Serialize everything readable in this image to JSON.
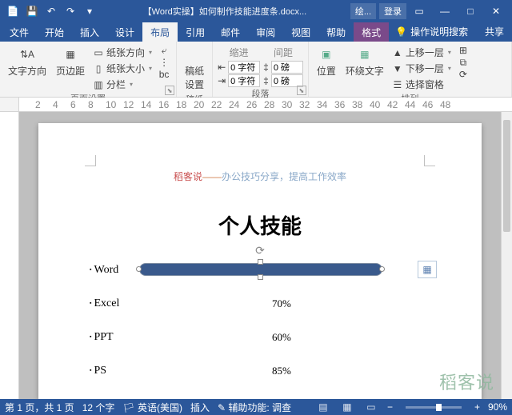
{
  "titlebar": {
    "title": "【Word实操】如何制作技能进度条.docx...",
    "app_badge": "绘...",
    "login": "登录"
  },
  "tabs": {
    "file": "文件",
    "home": "开始",
    "insert": "插入",
    "design": "设计",
    "layout": "布局",
    "references": "引用",
    "mailings": "邮件",
    "review": "审阅",
    "view": "视图",
    "help": "帮助",
    "format": "格式",
    "tell": "操作说明搜索",
    "share": "共享"
  },
  "ribbon": {
    "page_setup": {
      "label": "页面设置",
      "text_direction": "文字方向",
      "margins": "页边距",
      "orientation": "纸张方向",
      "size": "纸张大小",
      "columns": "分栏"
    },
    "manuscript": {
      "label": "稿纸",
      "settings": "稿纸\n设置"
    },
    "paragraph": {
      "label": "段落",
      "indent": "缩进",
      "spacing": "间距",
      "left_val": "0 字符",
      "right_val": "0 字符",
      "before_val": "0 磅",
      "after_val": "0 磅"
    },
    "arrange": {
      "label": "排列",
      "position": "位置",
      "wrap": "环绕文字",
      "bring_forward": "上移一层",
      "send_backward": "下移一层",
      "selection_pane": "选择窗格"
    }
  },
  "document": {
    "header": {
      "brand": "稻客说",
      "dash": "——",
      "tagline": "办公技巧分享，提高工作效率"
    },
    "title": "个人技能",
    "skills": [
      {
        "name": "Word",
        "value": ""
      },
      {
        "name": "Excel",
        "value": "70%"
      },
      {
        "name": "PPT",
        "value": "60%"
      },
      {
        "name": "PS",
        "value": "85%"
      }
    ]
  },
  "ruler": {
    "h": [
      "2",
      "4",
      "6",
      "8",
      "10",
      "12",
      "14",
      "16",
      "18",
      "20",
      "22",
      "24",
      "26",
      "28",
      "30",
      "32",
      "34",
      "36",
      "38",
      "40",
      "42",
      "44",
      "46",
      "48"
    ]
  },
  "status": {
    "page": "第 1 页，共 1 页",
    "words": "12 个字",
    "lang": "英语(美国)",
    "insert": "插入",
    "a11y": "辅助功能: 调查",
    "zoom": "90%"
  },
  "watermark": "稻客说"
}
